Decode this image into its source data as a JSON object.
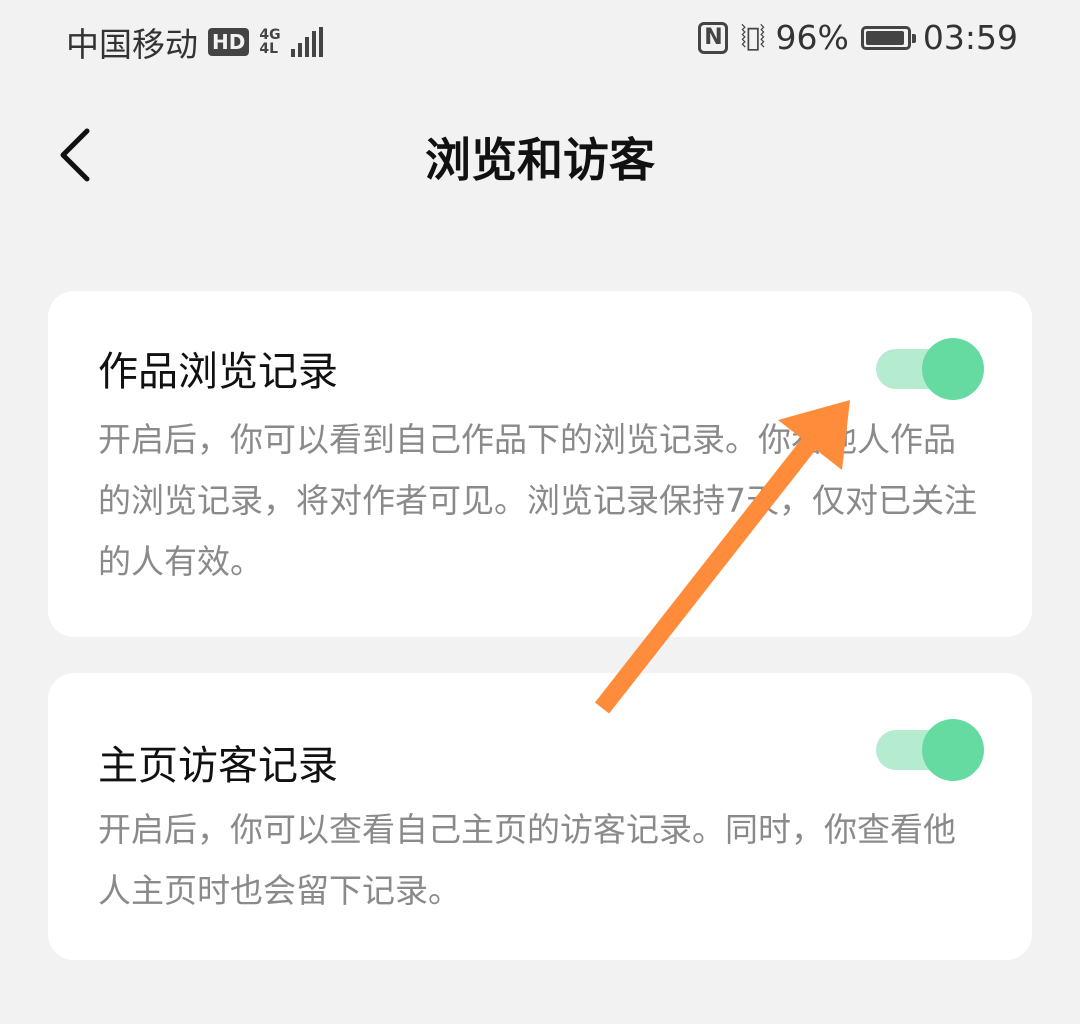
{
  "status_bar": {
    "carrier": "中国移动",
    "hd_badge": "HD",
    "network_top": "4G",
    "network_bottom": "4L",
    "nfc": "N",
    "battery_percent": "96%",
    "battery_level": 0.96,
    "time": "03:59"
  },
  "header": {
    "title": "浏览和访客"
  },
  "settings": [
    {
      "title": "作品浏览记录",
      "description": "开启后，你可以看到自己作品下的浏览记录。你看他人作品的浏览记录，将对作者可见。浏览记录保持7天，仅对已关注的人有效。",
      "enabled": true
    },
    {
      "title": "主页访客记录",
      "description": "开启后，你可以查看自己主页的访客记录。同时，你查看他人主页时也会留下记录。",
      "enabled": true
    }
  ],
  "colors": {
    "toggle_on": "#66dba1",
    "toggle_track_on": "#b5ecd0",
    "annotation_arrow": "#ff8c3a"
  }
}
